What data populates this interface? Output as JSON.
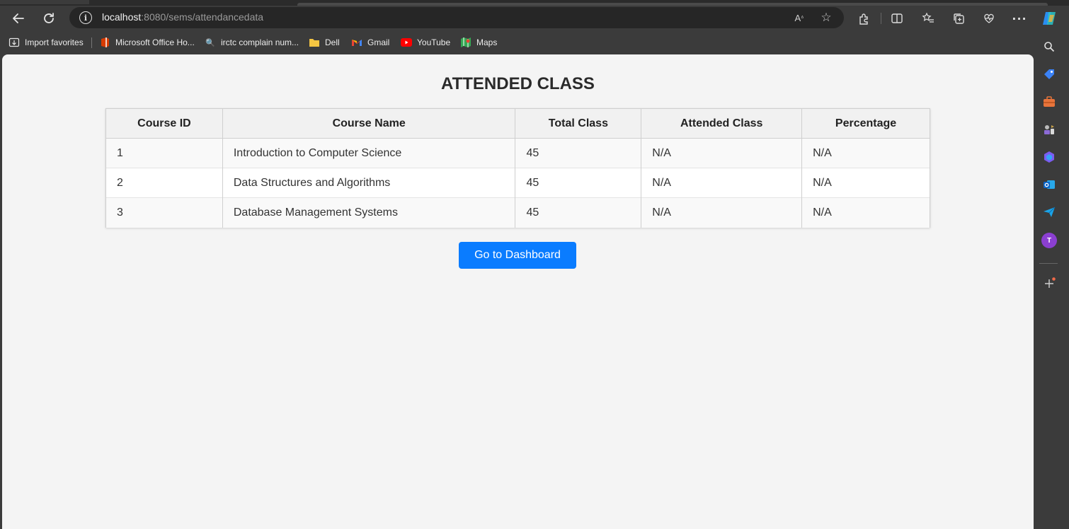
{
  "browser": {
    "url_host": "localhost",
    "url_rest": ":8080/sems/attendancedata",
    "icons": {
      "back": "back-arrow-icon",
      "refresh": "refresh-icon",
      "info": "info-icon",
      "read_aloud": "read-aloud-icon",
      "favorite": "star-icon",
      "extensions": "extensions-icon",
      "split_screen": "split-screen-icon",
      "favorites": "favorites-icon",
      "collections": "collections-icon",
      "browser_essentials": "heart-pulse-icon",
      "more": "more-icon",
      "copilot": "copilot-icon"
    }
  },
  "bookmarks": [
    {
      "label": "Import favorites",
      "icon": "import-icon"
    },
    {
      "label": "Microsoft Office Ho...",
      "icon": "office-icon"
    },
    {
      "label": "irctc complain num...",
      "icon": "search-icon"
    },
    {
      "label": "Dell",
      "icon": "folder-icon"
    },
    {
      "label": "Gmail",
      "icon": "gmail-icon"
    },
    {
      "label": "YouTube",
      "icon": "youtube-icon"
    },
    {
      "label": "Maps",
      "icon": "maps-icon"
    }
  ],
  "sidebar": {
    "avatar_letter": "T",
    "icons": [
      "search-icon",
      "shopping-tag-icon",
      "tools-icon",
      "games-icon",
      "office-icon",
      "outlook-icon",
      "send-icon",
      "avatar",
      "add-icon"
    ]
  },
  "page": {
    "title": "ATTENDED CLASS",
    "columns": [
      "Course ID",
      "Course Name",
      "Total Class",
      "Attended Class",
      "Percentage"
    ],
    "rows": [
      [
        "1",
        "Introduction to Computer Science",
        "45",
        "N/A",
        "N/A"
      ],
      [
        "2",
        "Data Structures and Algorithms",
        "45",
        "N/A",
        "N/A"
      ],
      [
        "3",
        "Database Management Systems",
        "45",
        "N/A",
        "N/A"
      ]
    ],
    "button_label": "Go to Dashboard"
  },
  "colors": {
    "button": "#0a7cff",
    "page_bg": "#f4f4f4",
    "chrome_bg": "#3b3b3b"
  }
}
